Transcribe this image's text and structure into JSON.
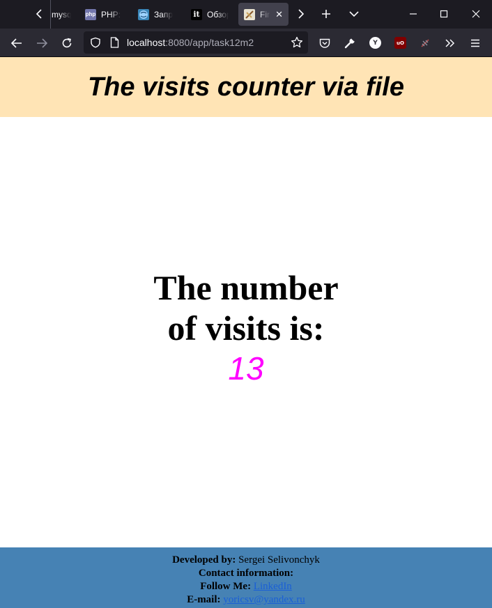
{
  "browser": {
    "tabs": [
      {
        "label": "mysql"
      },
      {
        "label": "PHP: c"
      },
      {
        "label": "Запро"
      },
      {
        "label": "Обзор"
      },
      {
        "label": "First"
      }
    ],
    "favicons": {
      "php": "php",
      "it": "it"
    },
    "url_host": "localhost",
    "url_rest": ":8080/app/task12m2",
    "ext_yandex": "Y",
    "ext_ublock": "uO"
  },
  "page": {
    "title": "The visits counter via file",
    "visits_line1": "The number",
    "visits_line2": "of visits is:",
    "visits_count": "13",
    "count_color": "#ff00ff",
    "header_bg": "#ffe4b5",
    "footer_bg": "#4682b4"
  },
  "footer": {
    "developed_label": "Developed by:",
    "developer": "Sergei Selivonchyk",
    "contact_label": "Contact information:",
    "follow_label": "Follow Me:",
    "follow_link": "LinkedIn",
    "email_label": "E-mail:",
    "email": "yoricsv@yandex.ru"
  }
}
